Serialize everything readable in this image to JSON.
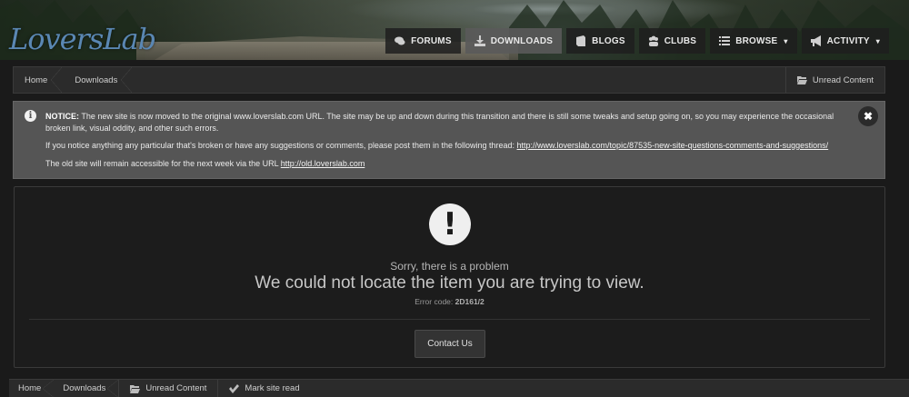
{
  "site": {
    "logo": "LoversLab"
  },
  "nav": {
    "items": [
      {
        "label": "Forums",
        "icon": "comments-icon"
      },
      {
        "label": "Downloads",
        "icon": "download-icon"
      },
      {
        "label": "Blogs",
        "icon": "book-icon"
      },
      {
        "label": "Clubs",
        "icon": "users-icon"
      },
      {
        "label": "Browse",
        "icon": "list-icon",
        "caret": "▾"
      },
      {
        "label": "Activity",
        "icon": "bullhorn-icon",
        "caret": "▾"
      }
    ],
    "active": "Downloads"
  },
  "breadcrumb": {
    "items": [
      "Home",
      "Downloads"
    ],
    "unread": "Unread Content"
  },
  "notice": {
    "label": "NOTICE:",
    "line1": " The new site is now moved to the original www.loverslab.com URL. The site may be up and down during this transition and there is still some tweaks and setup going on, so you may experience the occasional broken link, visual oddity, and other such errors.",
    "line2_prefix": "If you notice anything any particular that's broken or have any suggestions or comments, please post them in the following thread: ",
    "line2_link": "http://www.loverslab.com/topic/87535-new-site-questions-comments-and-suggestions/",
    "line3_prefix": "The old site will remain accessible for the next week via the URL ",
    "line3_link": "http://old.loverslab.com",
    "close": "✖"
  },
  "error": {
    "icon": "!",
    "sorry": "Sorry, there is a problem",
    "message": "We could not locate the item you are trying to view.",
    "code_label": "Error code: ",
    "code": "2D161/2",
    "contact_button": "Contact Us"
  },
  "footer_bar": {
    "items": [
      "Home",
      "Downloads"
    ],
    "unread": "Unread Content",
    "mark_read": "Mark site read"
  }
}
